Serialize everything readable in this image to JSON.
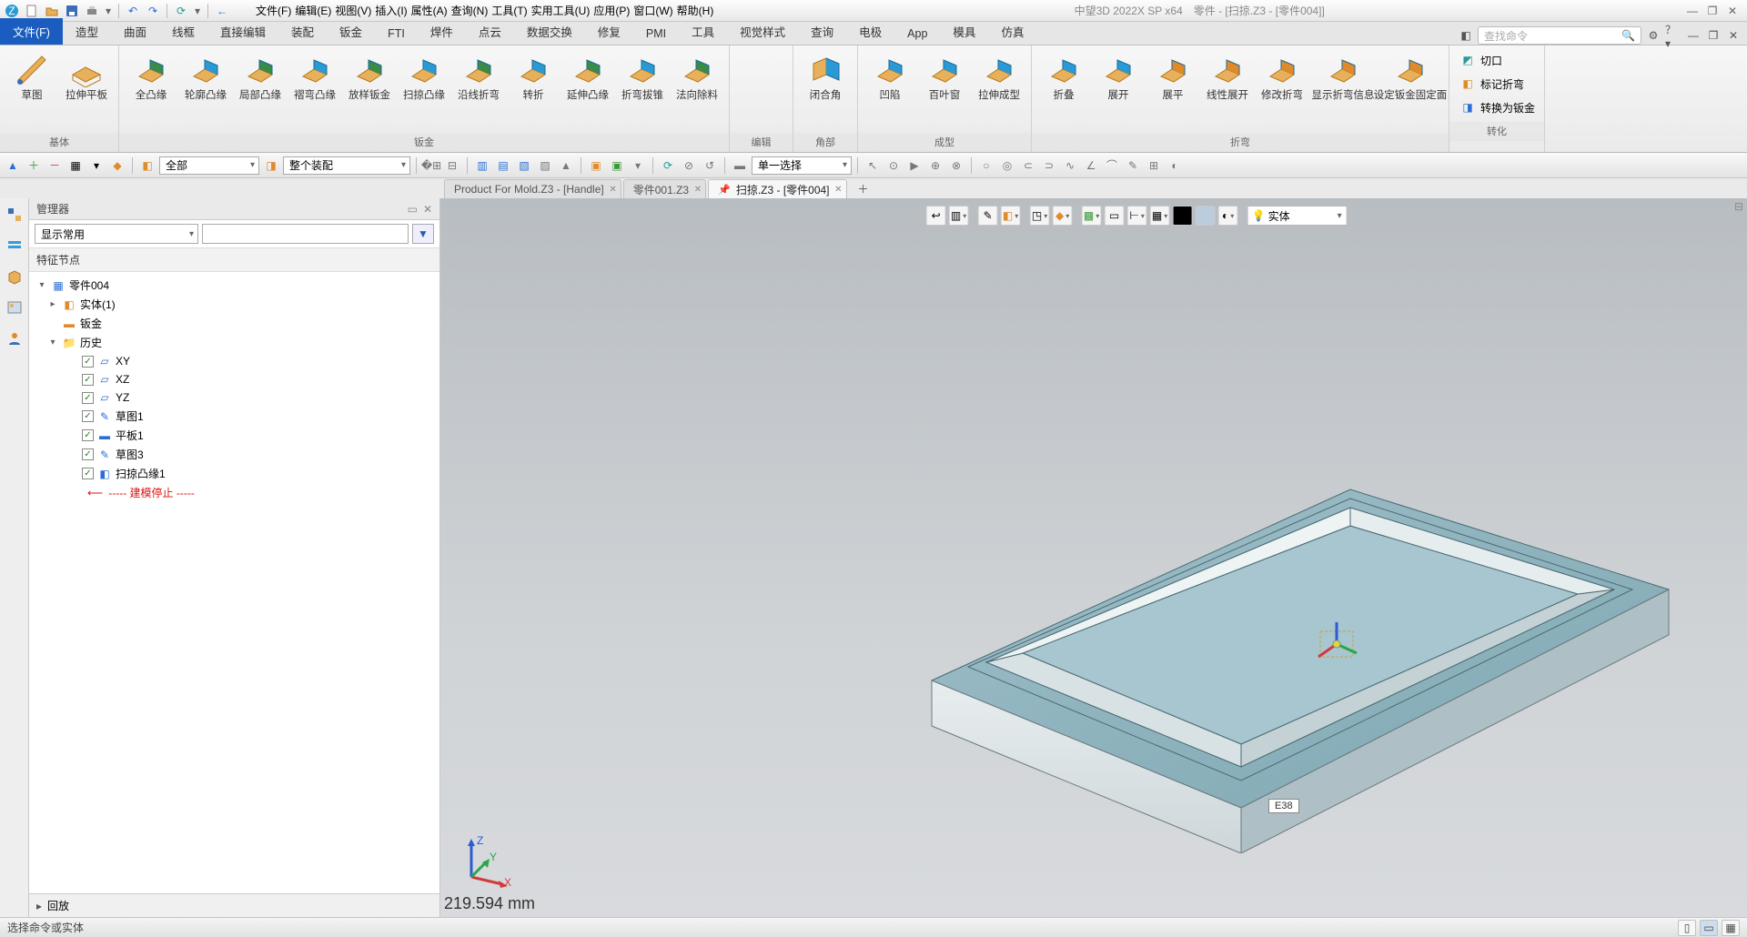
{
  "app": {
    "name": "中望3D 2022X SP x64",
    "doc": "零件 - [扫掠.Z3 - [零件004]]"
  },
  "menubar": [
    "文件(F)",
    "编辑(E)",
    "视图(V)",
    "插入(I)",
    "属性(A)",
    "查询(N)",
    "工具(T)",
    "实用工具(U)",
    "应用(P)",
    "窗口(W)",
    "帮助(H)"
  ],
  "ribbon_tabs": [
    "文件(F)",
    "造型",
    "曲面",
    "线框",
    "直接编辑",
    "装配",
    "钣金",
    "FTI",
    "焊件",
    "点云",
    "数据交换",
    "修复",
    "PMI",
    "工具",
    "视觉样式",
    "查询",
    "电极",
    "App",
    "模具",
    "仿真"
  ],
  "ribbon_active": "文件(F)",
  "search_placeholder": "查找命令",
  "ribbon_groups": {
    "g1": {
      "label": "基体",
      "buttons": [
        "草图",
        "拉伸平板"
      ]
    },
    "g2": {
      "label": "钣金",
      "buttons": [
        "全凸缘",
        "轮廓凸缘",
        "局部凸缘",
        "褶弯凸缘",
        "放样钣金",
        "扫掠凸缘",
        "沿线折弯",
        "转折",
        "延伸凸缘",
        "折弯拔锥",
        "法向除料"
      ]
    },
    "g3": {
      "label": "编辑",
      "buttons": []
    },
    "g4": {
      "label": "角部",
      "buttons": [
        "闭合角"
      ]
    },
    "g5": {
      "label": "成型",
      "buttons": [
        "凹陷",
        "百叶窗",
        "拉伸成型"
      ]
    },
    "g6": {
      "label": "折弯",
      "buttons": [
        "折叠",
        "展开",
        "展平",
        "线性展开",
        "修改折弯",
        "显示折弯信息",
        "设定钣金固定面"
      ]
    },
    "g7": {
      "label": "转化",
      "rows": [
        "切口",
        "标记折弯",
        "转换为钣金"
      ]
    }
  },
  "toolstrip": {
    "combo1": "全部",
    "combo2": "整个装配",
    "combo3": "单一选择"
  },
  "manager": {
    "title": "管理器",
    "filter_mode": "显示常用",
    "section": "特征节点",
    "root": "零件004",
    "nodes": [
      {
        "label": "实体(1)",
        "icon": "cube",
        "exp": "▸"
      },
      {
        "label": "钣金",
        "icon": "sheet",
        "exp": ""
      },
      {
        "label": "历史",
        "icon": "folder",
        "exp": "▾",
        "children": [
          {
            "label": "XY",
            "icon": "plane"
          },
          {
            "label": "XZ",
            "icon": "plane"
          },
          {
            "label": "YZ",
            "icon": "plane"
          },
          {
            "label": "草图1",
            "icon": "sketch"
          },
          {
            "label": "平板1",
            "icon": "slab"
          },
          {
            "label": "草图3",
            "icon": "sketch"
          },
          {
            "label": "扫掠凸缘1",
            "icon": "sweep"
          }
        ]
      }
    ],
    "stop": "----- 建模停止 -----",
    "footer": "回放"
  },
  "doctabs": [
    {
      "label": "Product For Mold.Z3 - [Handle]",
      "active": false
    },
    {
      "label": "零件001.Z3",
      "active": false
    },
    {
      "label": "扫掠.Z3 - [零件004]",
      "active": true,
      "pinned": true
    }
  ],
  "viewport": {
    "display_combo": "实体",
    "edge_tag": "E38",
    "readout": "219.594 mm",
    "axes": [
      "X",
      "Y",
      "Z"
    ]
  },
  "statusbar": {
    "hint": "选择命令或实体"
  }
}
